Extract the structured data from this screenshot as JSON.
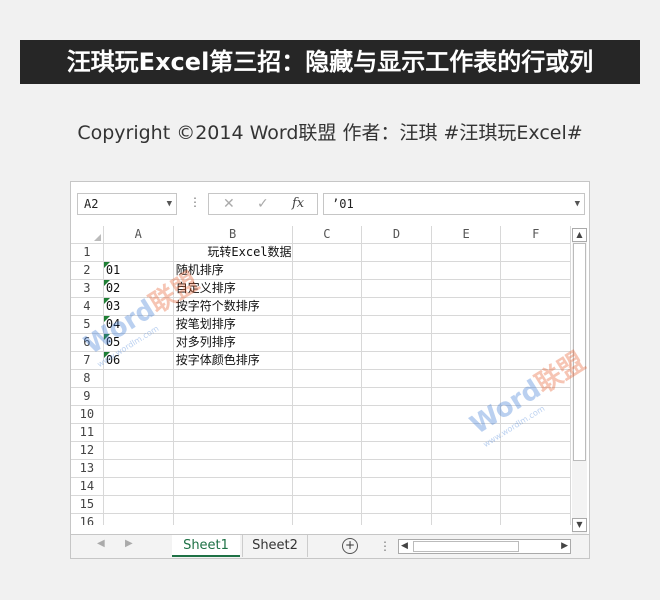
{
  "banner": {
    "title": "汪琪玩Excel第三招：隐藏与显示工作表的行或列"
  },
  "copyright": {
    "text": "Copyright ©2014 Word联盟    作者：汪琪   #汪琪玩Excel#"
  },
  "formula_bar": {
    "name_box": "A2",
    "cancel_icon": "✕",
    "enter_icon": "✓",
    "fx_label": "fx",
    "content": "’01"
  },
  "columns": [
    "A",
    "B",
    "C",
    "D",
    "E",
    "F"
  ],
  "rows": [
    {
      "n": "1",
      "a": "",
      "b": "玩转Excel数据",
      "flag": false
    },
    {
      "n": "2",
      "a": "01",
      "b": "随机排序",
      "flag": true
    },
    {
      "n": "3",
      "a": "02",
      "b": "自定义排序",
      "flag": true
    },
    {
      "n": "4",
      "a": "03",
      "b": "按字符个数排序",
      "flag": true
    },
    {
      "n": "5",
      "a": "04",
      "b": "按笔划排序",
      "flag": true
    },
    {
      "n": "6",
      "a": "05",
      "b": "对多列排序",
      "flag": true
    },
    {
      "n": "7",
      "a": "06",
      "b": "按字体颜色排序",
      "flag": true
    },
    {
      "n": "8",
      "a": "",
      "b": "",
      "flag": false
    },
    {
      "n": "9",
      "a": "",
      "b": "",
      "flag": false
    },
    {
      "n": "10",
      "a": "",
      "b": "",
      "flag": false
    },
    {
      "n": "11",
      "a": "",
      "b": "",
      "flag": false
    },
    {
      "n": "12",
      "a": "",
      "b": "",
      "flag": false
    },
    {
      "n": "13",
      "a": "",
      "b": "",
      "flag": false
    },
    {
      "n": "14",
      "a": "",
      "b": "",
      "flag": false
    },
    {
      "n": "15",
      "a": "",
      "b": "",
      "flag": false
    },
    {
      "n": "16",
      "a": "",
      "b": "",
      "flag": false
    }
  ],
  "tabs": {
    "sheet1": "Sheet1",
    "sheet2": "Sheet2",
    "add": "+"
  },
  "watermark": {
    "word": "Word",
    "cn": "联盟",
    "url": "www.wordlm.com"
  },
  "colors": {
    "banner_bg": "#262626",
    "excel_green": "#1e7145",
    "error_flag": "#1e7e34",
    "watermark_blue": "#3c7bd6",
    "watermark_orange": "#e85b2a"
  }
}
